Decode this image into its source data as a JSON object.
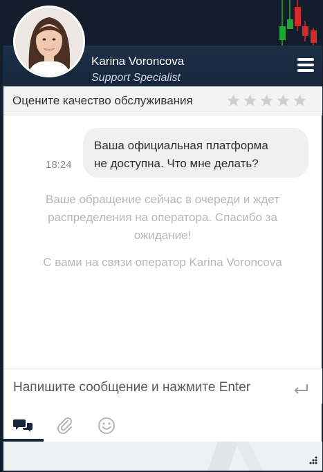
{
  "agent": {
    "name": "Karina Voroncova",
    "role": "Support Specialist"
  },
  "rating": {
    "label": "Оцените качество обслуживания",
    "max_stars": 5,
    "selected": 0
  },
  "messages": {
    "user_message": {
      "time": "18:24",
      "line1": "Ваша официальная платформа",
      "line2": "не доступна. Что мне делать?"
    },
    "system_queue": {
      "line1": "Ваше обращение сейчас в очереди и ждет",
      "line2": "распределения на оператора. Спасибо за",
      "line3": "ожидание!"
    },
    "system_operator": "С вами на связи оператор Karina Voroncova"
  },
  "composer": {
    "placeholder": "Напишите сообщение и нажмите Enter"
  },
  "toolbar": {
    "tools": [
      "chat-icon",
      "attach-icon",
      "emoji-icon"
    ],
    "active": "chat-icon"
  },
  "colors": {
    "header_bg": "#1c2f47",
    "accent_dark": "#15253a",
    "bubble_bg": "#f0f0f0",
    "system_text": "#b7b7b7",
    "star_inactive": "#cfcfcf"
  }
}
